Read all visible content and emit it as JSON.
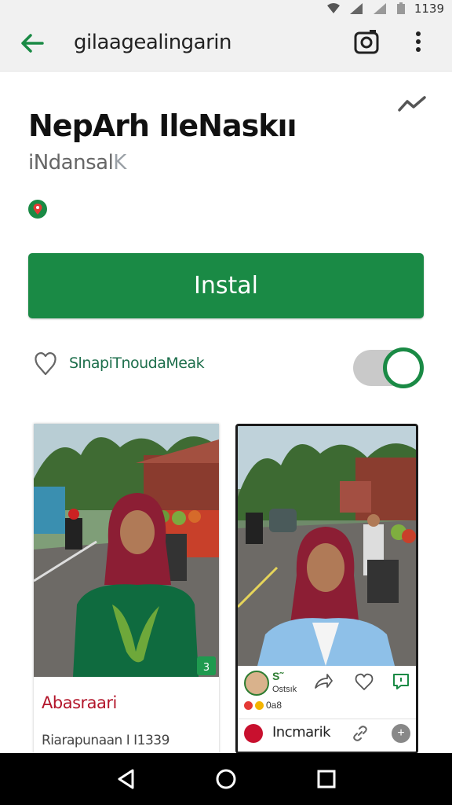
{
  "status_bar": {
    "time": "1139",
    "icons": [
      "wifi-icon",
      "signal-icon",
      "signal-icon",
      "battery-icon"
    ]
  },
  "app_bar": {
    "title": "gilaagealingarin",
    "icons": [
      "back-arrow-icon",
      "camera-icon",
      "more-vert-icon"
    ]
  },
  "app": {
    "name": "NepArh IleNaskıı",
    "subtitle_main": "iNdansal",
    "subtitle_mark": "K",
    "install_label": "Instal"
  },
  "wishlist": {
    "label": "SlnapiTnoudaMeak",
    "toggle_on": true
  },
  "screenshots": {
    "card1": {
      "title": "Abasraari",
      "subtitle": "Riarapunaan I I1339",
      "badge": "3"
    },
    "card2": {
      "status_time": "",
      "profile_name": "S˜",
      "profile_handle": "Ostsık",
      "reaction_count": "0a8",
      "action_label": "Incmarik",
      "plus": "+"
    }
  },
  "colors": {
    "accent": "#1a8a45",
    "title_red": "#b3162b",
    "link_green": "#1e6f4c"
  },
  "nav_bar": {
    "icons": [
      "nav-back-icon",
      "nav-home-icon",
      "nav-recents-icon"
    ]
  }
}
